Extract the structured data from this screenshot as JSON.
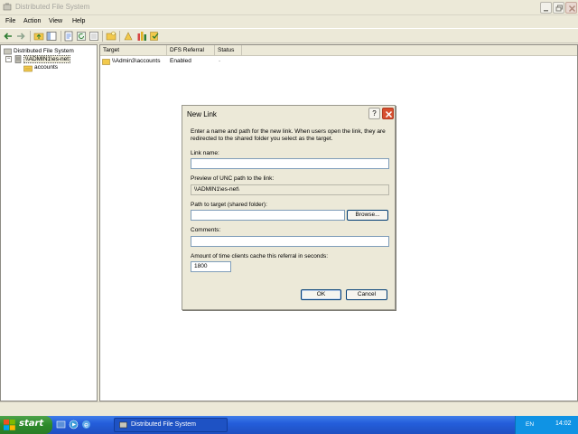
{
  "window": {
    "title": "Distributed File System"
  },
  "menu": {
    "file": "File",
    "action": "Action",
    "view": "View",
    "help": "Help"
  },
  "tree": {
    "root": "Distributed File System",
    "server": "\\\\ADMIN1\\es-net",
    "child": "accounts"
  },
  "list": {
    "columns": [
      "Target",
      "DFS Referral",
      "Status"
    ],
    "rows": [
      {
        "target": "\\\\Admin3\\accounts",
        "referral": "Enabled",
        "status": "-"
      }
    ]
  },
  "dialog": {
    "title": "New Link",
    "help_glyph": "?",
    "intro": "Enter a name and path for the new link. When users open the link, they are redirected to the shared folder you select as the target.",
    "link_name_label": "Link name:",
    "link_name_value": "",
    "preview_label": "Preview of UNC path to the link:",
    "preview_value": "\\\\ADMIN1\\es-net\\",
    "path_label": "Path to target (shared folder):",
    "path_value": "",
    "browse_label": "Browse...",
    "comments_label": "Comments:",
    "comments_value": "",
    "cache_label": "Amount of time clients cache this referral in seconds:",
    "cache_value": "1800",
    "ok_label": "OK",
    "cancel_label": "Cancel"
  },
  "taskbar": {
    "start_label": "start",
    "task_label": "Distributed File System",
    "language": "EN",
    "clock": "14:02"
  },
  "colors": {
    "taskbar_blue": "#245edb",
    "start_green": "#2d8a2a",
    "tray_blue": "#0f93e4"
  }
}
